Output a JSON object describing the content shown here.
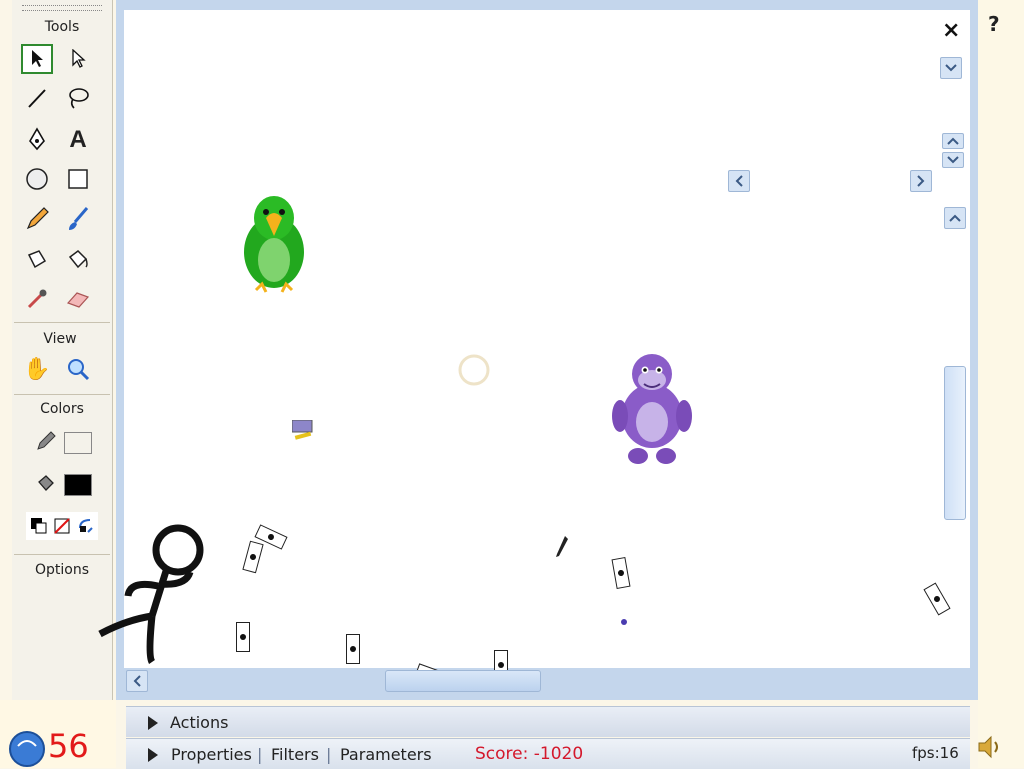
{
  "toolbar": {
    "tools_label": "Tools",
    "view_label": "View",
    "colors_label": "Colors",
    "options_label": "Options"
  },
  "stage": {
    "close_symbol": "×"
  },
  "help_symbol": "?",
  "panels": {
    "actions_label": "Actions",
    "properties_label": "Properties",
    "filters_label": "Filters",
    "parameters_label": "Parameters",
    "separator": "|"
  },
  "hud": {
    "score_text": "Score: -1020",
    "fps_text": "fps:16",
    "lives": "56"
  },
  "colors": {
    "score": "#d4182c",
    "lives": "#e21a1a",
    "tool_selected_border": "#2f8a2f",
    "stage_frame": "#c4d6ec",
    "parrot": "#22a81e",
    "gorilla": "#8a5cc8"
  },
  "icons": [
    "selection-arrow-icon",
    "subselection-arrow-icon",
    "line-icon",
    "lasso-icon",
    "pen-icon",
    "text-icon",
    "oval-icon",
    "rectangle-icon",
    "pencil-icon",
    "brush-icon",
    "ink-bottle-icon",
    "paint-bucket-icon",
    "eyedropper-icon",
    "eraser-icon",
    "hand-icon",
    "zoom-icon",
    "stroke-color-icon",
    "fill-color-icon",
    "swap-colors-icon",
    "no-color-icon",
    "speaker-icon",
    "close-icon",
    "help-icon"
  ]
}
